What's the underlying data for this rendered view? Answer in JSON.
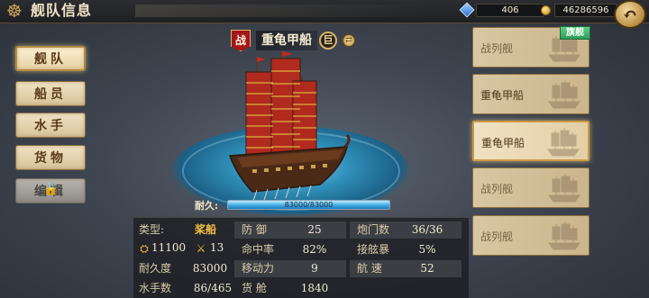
{
  "header": {
    "title": "舰队信息",
    "gems": "406",
    "gold": "46286596"
  },
  "tabs": [
    {
      "label": "舰队",
      "active": true
    },
    {
      "label": "船员",
      "active": false
    },
    {
      "label": "水手",
      "active": false
    },
    {
      "label": "货物",
      "active": false
    },
    {
      "label": "编辑",
      "active": false,
      "locked": true
    }
  ],
  "ship": {
    "badge": "战",
    "name": "重龟甲船",
    "size_badge": "巨",
    "durability_label": "耐久:",
    "durability_text": "83000/83000",
    "durability_fraction": 1.0
  },
  "stats": {
    "type_label": "类型:",
    "type_value": "桨船",
    "cannon_value": "11100",
    "melee_value": "13",
    "durability_label": "耐久度",
    "durability_value": "83000",
    "sailors_label": "水手数",
    "sailors_value": "86/465",
    "defense_label": "防 御",
    "defense_value": "25",
    "accuracy_label": "命中率",
    "accuracy_value": "82%",
    "mobility_label": "移动力",
    "mobility_value": "9",
    "cargo_label": "货 舱",
    "cargo_value": "1840",
    "gunports_label": "炮门数",
    "gunports_value": "36/36",
    "boarding_label": "接舷暴",
    "boarding_value": "5%",
    "speed_label": "航 速",
    "speed_value": "52"
  },
  "ship_list": [
    {
      "name": "战列舰",
      "flag": "旗舰",
      "selected": false,
      "faded": true
    },
    {
      "name": "重龟甲船",
      "selected": false,
      "faded": false
    },
    {
      "name": "重龟甲船",
      "selected": true,
      "faded": false
    },
    {
      "name": "战列舰",
      "selected": false,
      "faded": true
    },
    {
      "name": "战列舰",
      "selected": false,
      "faded": true
    }
  ],
  "colors": {
    "accent_gold": "#f2c040",
    "durability_blue": "#3aa5e0",
    "battle_red": "#a3161a",
    "flag_green": "#2e9c5a"
  }
}
